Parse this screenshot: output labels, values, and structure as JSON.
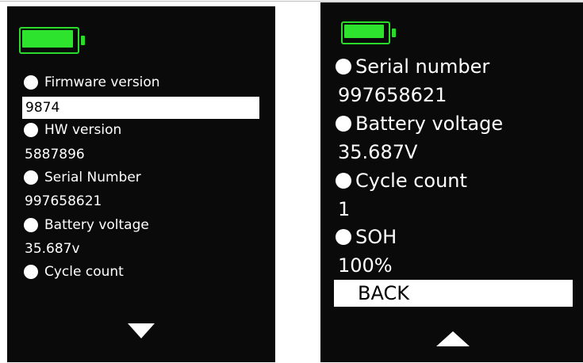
{
  "colors": {
    "screen_background": "#0a0a0a",
    "text": "#ffffff",
    "selection_background": "#ffffff",
    "selection_text": "#000000",
    "battery": "#2ee32e"
  },
  "left_screen": {
    "battery_icon": "battery-full-icon",
    "items": [
      {
        "label": "Firmware version",
        "value": "9874",
        "selected": true
      },
      {
        "label": "HW version",
        "value": "5887896"
      },
      {
        "label": "Serial Number",
        "value": "997658621"
      },
      {
        "label": "Battery voltage",
        "value": "35.687v"
      },
      {
        "label": "Cycle count"
      }
    ],
    "nav_icon": "arrow-down-icon"
  },
  "right_screen": {
    "battery_icon": "battery-full-icon",
    "items": [
      {
        "label": "Serial number",
        "value": "997658621"
      },
      {
        "label": "Battery voltage",
        "value": "35.687V"
      },
      {
        "label": "Cycle count",
        "value": "1"
      },
      {
        "label": "SOH",
        "value": "100%"
      }
    ],
    "back_label": "BACK",
    "nav_icon": "arrow-up-icon"
  }
}
